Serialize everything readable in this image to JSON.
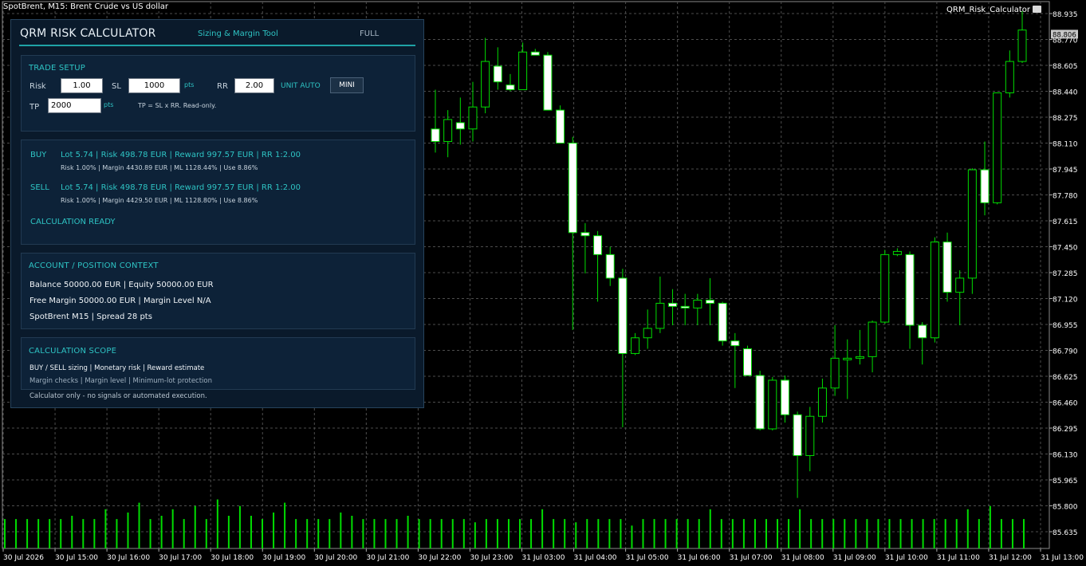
{
  "chart_window": {
    "title": "SpotBrent, M15:  Brent Crude vs US dollar",
    "indicator_label": "QRM_Risk_Calculator",
    "indicator_icon": "hat-icon",
    "current_price": "88.806"
  },
  "colors": {
    "background": "#000000",
    "grid": "#4d4d4d",
    "bull_candle": "#000000",
    "bear_candle": "#ffffff",
    "wick": "#00dd00",
    "volume": "#00dd00",
    "accent": "#2ec4c4",
    "panel_bg": "#0a1a2b"
  },
  "chart_data": {
    "type": "candlestick",
    "price_axis_ticks": [
      "88.935",
      "88.770",
      "88.605",
      "88.440",
      "88.275",
      "88.110",
      "87.945",
      "87.780",
      "87.615",
      "87.450",
      "87.285",
      "87.120",
      "86.955",
      "86.790",
      "86.625",
      "86.460",
      "86.295",
      "86.130",
      "85.965",
      "85.800",
      "85.635"
    ],
    "time_axis_ticks": [
      "30 Jul 2026",
      "30 Jul 15:00",
      "30 Jul 16:00",
      "30 Jul 17:00",
      "30 Jul 18:00",
      "30 Jul 19:00",
      "30 Jul 20:00",
      "30 Jul 21:00",
      "30 Jul 22:00",
      "30 Jul 23:00",
      "31 Jul 03:00",
      "31 Jul 04:00",
      "31 Jul 05:00",
      "31 Jul 06:00",
      "31 Jul 07:00",
      "31 Jul 08:00",
      "31 Jul 09:00",
      "31 Jul 10:00",
      "31 Jul 11:00",
      "31 Jul 12:00",
      "31 Jul 13:00"
    ],
    "ylim": [
      85.6,
      89.0
    ],
    "candles": [
      {
        "o": 88.2,
        "h": 88.45,
        "l": 88.05,
        "c": 88.12
      },
      {
        "o": 88.12,
        "h": 88.32,
        "l": 88.02,
        "c": 88.26
      },
      {
        "o": 88.24,
        "h": 88.4,
        "l": 88.1,
        "c": 88.2
      },
      {
        "o": 88.2,
        "h": 88.5,
        "l": 88.12,
        "c": 88.34
      },
      {
        "o": 88.34,
        "h": 88.78,
        "l": 88.3,
        "c": 88.63
      },
      {
        "o": 88.6,
        "h": 88.72,
        "l": 88.45,
        "c": 88.5
      },
      {
        "o": 88.48,
        "h": 88.55,
        "l": 88.44,
        "c": 88.45
      },
      {
        "o": 88.45,
        "h": 88.75,
        "l": 88.45,
        "c": 88.69
      },
      {
        "o": 88.69,
        "h": 88.71,
        "l": 88.67,
        "c": 88.67
      },
      {
        "o": 88.67,
        "h": 88.69,
        "l": 88.32,
        "c": 88.32
      },
      {
        "o": 88.32,
        "h": 88.35,
        "l": 88.11,
        "c": 88.11
      },
      {
        "o": 88.11,
        "h": 88.15,
        "l": 86.92,
        "c": 87.54
      },
      {
        "o": 87.54,
        "h": 87.6,
        "l": 87.28,
        "c": 87.52
      },
      {
        "o": 87.52,
        "h": 87.55,
        "l": 87.1,
        "c": 87.4
      },
      {
        "o": 87.4,
        "h": 87.45,
        "l": 87.2,
        "c": 87.25
      },
      {
        "o": 87.25,
        "h": 87.31,
        "l": 86.3,
        "c": 86.77
      },
      {
        "o": 86.77,
        "h": 86.9,
        "l": 86.76,
        "c": 86.87
      },
      {
        "o": 86.87,
        "h": 87.05,
        "l": 86.8,
        "c": 86.93
      },
      {
        "o": 86.93,
        "h": 87.26,
        "l": 86.9,
        "c": 87.09
      },
      {
        "o": 87.09,
        "h": 87.18,
        "l": 86.95,
        "c": 87.07
      },
      {
        "o": 87.07,
        "h": 87.15,
        "l": 86.95,
        "c": 87.06
      },
      {
        "o": 87.06,
        "h": 87.15,
        "l": 86.95,
        "c": 87.11
      },
      {
        "o": 87.11,
        "h": 87.25,
        "l": 86.95,
        "c": 87.09
      },
      {
        "o": 87.09,
        "h": 87.1,
        "l": 86.82,
        "c": 86.85
      },
      {
        "o": 86.85,
        "h": 86.9,
        "l": 86.55,
        "c": 86.82
      },
      {
        "o": 86.8,
        "h": 86.82,
        "l": 86.63,
        "c": 86.63
      },
      {
        "o": 86.63,
        "h": 86.66,
        "l": 86.28,
        "c": 86.29
      },
      {
        "o": 86.29,
        "h": 86.62,
        "l": 86.28,
        "c": 86.6
      },
      {
        "o": 86.6,
        "h": 86.63,
        "l": 86.33,
        "c": 86.38
      },
      {
        "o": 86.38,
        "h": 86.4,
        "l": 85.85,
        "c": 86.12
      },
      {
        "o": 86.12,
        "h": 86.43,
        "l": 86.02,
        "c": 86.37
      },
      {
        "o": 86.37,
        "h": 86.61,
        "l": 86.33,
        "c": 86.55
      },
      {
        "o": 86.55,
        "h": 86.95,
        "l": 86.5,
        "c": 86.74
      },
      {
        "o": 86.74,
        "h": 86.86,
        "l": 86.48,
        "c": 86.74
      },
      {
        "o": 86.74,
        "h": 86.92,
        "l": 86.7,
        "c": 86.75
      },
      {
        "o": 86.75,
        "h": 86.98,
        "l": 86.65,
        "c": 86.97
      },
      {
        "o": 86.97,
        "h": 87.43,
        "l": 86.96,
        "c": 87.4
      },
      {
        "o": 87.4,
        "h": 87.44,
        "l": 87.39,
        "c": 87.42
      },
      {
        "o": 87.4,
        "h": 87.42,
        "l": 86.8,
        "c": 86.95
      },
      {
        "o": 86.95,
        "h": 86.97,
        "l": 86.7,
        "c": 86.87
      },
      {
        "o": 86.87,
        "h": 87.51,
        "l": 86.84,
        "c": 87.48
      },
      {
        "o": 87.48,
        "h": 87.54,
        "l": 87.1,
        "c": 87.16
      },
      {
        "o": 87.16,
        "h": 87.3,
        "l": 86.95,
        "c": 87.25
      },
      {
        "o": 87.25,
        "h": 87.95,
        "l": 87.15,
        "c": 87.94
      },
      {
        "o": 87.94,
        "h": 88.12,
        "l": 87.65,
        "c": 87.73
      },
      {
        "o": 87.73,
        "h": 88.42,
        "l": 87.72,
        "c": 88.43
      },
      {
        "o": 88.43,
        "h": 88.7,
        "l": 88.4,
        "c": 88.63
      },
      {
        "o": 88.63,
        "h": 88.95,
        "l": 88.62,
        "c": 88.83
      }
    ],
    "volume": [
      9,
      9,
      9,
      9,
      9,
      9,
      10,
      9,
      9,
      12,
      9,
      11,
      14,
      9,
      10,
      12,
      9,
      13,
      9,
      15,
      10,
      13,
      10,
      9,
      11,
      14,
      9,
      9,
      9,
      9,
      11,
      10,
      9,
      9,
      9,
      9,
      10,
      9,
      9,
      9,
      9,
      9,
      8,
      9,
      9,
      9,
      9,
      9,
      12,
      9,
      9,
      8,
      9,
      9,
      9,
      9,
      7,
      9,
      9,
      9,
      9,
      9,
      9,
      12,
      9,
      9,
      9,
      9,
      9,
      9,
      9,
      12,
      9,
      9,
      9,
      9,
      9,
      9,
      9,
      9,
      9,
      9,
      9,
      9,
      9,
      9,
      12,
      9,
      13,
      9,
      9,
      9
    ]
  },
  "panel": {
    "title": "QRM RISK CALCULATOR",
    "subtitle": "Sizing & Margin Tool",
    "mode_button": "FULL",
    "trade_setup": {
      "heading": "TRADE SETUP",
      "risk_label": "Risk",
      "risk_value": "1.00",
      "sl_label": "SL",
      "sl_value": "1000",
      "sl_unit": "pts",
      "rr_label": "RR",
      "rr_value": "2.00",
      "unit_auto": "UNIT AUTO",
      "mini_button": "MINI",
      "tp_label": "TP",
      "tp_value": "2000",
      "tp_unit": "pts",
      "tp_note": "TP = SL x RR. Read-only."
    },
    "results": {
      "buy_label": "BUY",
      "buy_main": "Lot 5.74 | Risk 498.78 EUR | Reward 997.57 EUR | RR 1:2.00",
      "buy_sub": "Risk 1.00% | Margin 4430.89 EUR | ML 1128.44% | Use 8.86%",
      "sell_label": "SELL",
      "sell_main": "Lot 5.74 | Risk 498.78 EUR | Reward 997.57 EUR | RR 1:2.00",
      "sell_sub": "Risk 1.00% | Margin 4429.50 EUR | ML 1128.80% | Use 8.86%",
      "status": "CALCULATION READY"
    },
    "account": {
      "heading": "ACCOUNT / POSITION CONTEXT",
      "line1": "Balance 50000.00 EUR | Equity 50000.00 EUR",
      "line2": "Free Margin 50000.00 EUR | Margin Level N/A",
      "line3": "SpotBrent M15 | Spread 28 pts"
    },
    "scope": {
      "heading": "CALCULATION SCOPE",
      "line1": "BUY / SELL sizing  |  Monetary risk  |  Reward estimate",
      "line2": "Margin checks  |  Margin level  |  Minimum-lot protection"
    },
    "footer": "Calculator only - no signals or automated execution."
  }
}
